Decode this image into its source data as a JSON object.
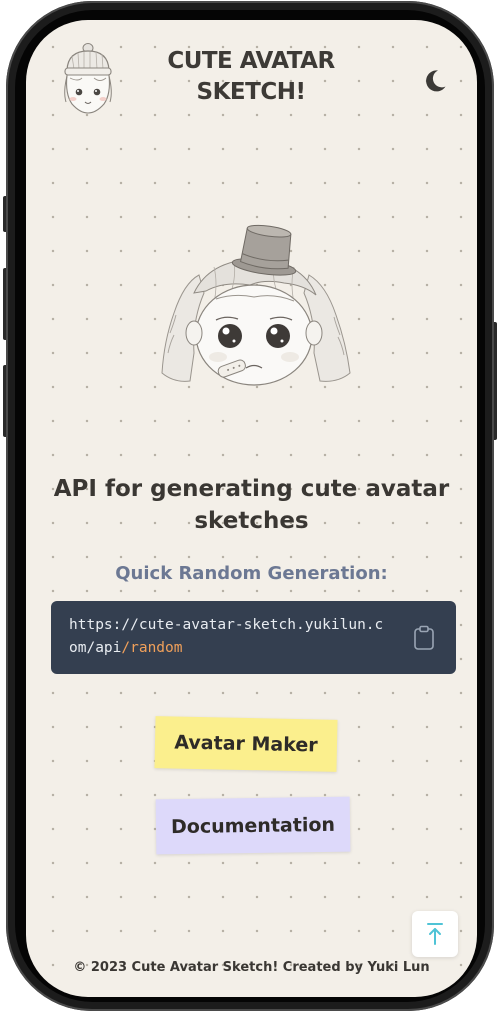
{
  "header": {
    "title_line1": "CUTE AVATAR",
    "title_line2": "SKETCH!",
    "logo_icon": "avatar-beanie-logo",
    "theme_toggle_icon": "moon-icon"
  },
  "hero": {
    "image_icon": "avatar-sketch-illustration"
  },
  "main": {
    "headline": "API for generating cute avatar sketches",
    "subhead": "Quick Random Generation:",
    "api_url_prefix": "https://cute-avatar-sketch.yukilun.com/api",
    "api_url_suffix": "/random",
    "copy_icon": "clipboard-icon"
  },
  "buttons": {
    "avatar_maker": "Avatar Maker",
    "documentation": "Documentation"
  },
  "scroll_top_icon": "arrow-up-icon",
  "footer": {
    "text": "© 2023 Cute Avatar Sketch! Created by Yuki Lun"
  },
  "colors": {
    "page_bg": "#f3efe8",
    "code_bg": "#343f50",
    "code_highlight": "#f0a05a",
    "note_yellow": "#fbef8d",
    "note_purple": "#ddd9fa",
    "subhead": "#6c7893",
    "scroll_arrow": "#4fc3d6"
  }
}
